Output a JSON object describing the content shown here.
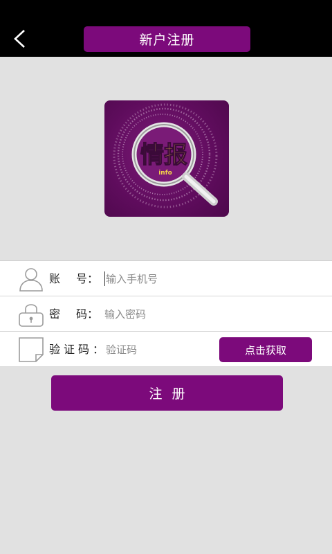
{
  "header": {
    "title": "新户注册",
    "back_icon": "chevron-left-icon"
  },
  "logo": {
    "text": "情报",
    "subtext": "info"
  },
  "form": {
    "account": {
      "label_a": "账",
      "label_b": "号：",
      "placeholder": "输入手机号",
      "icon": "user-icon"
    },
    "password": {
      "label_a": "密",
      "label_b": "码：",
      "placeholder": "输入密码",
      "icon": "lock-icon"
    },
    "code": {
      "label": "验证码：",
      "placeholder": "验证码",
      "icon": "note-icon",
      "button_label": "点击获取"
    }
  },
  "submit_label": "注册",
  "colors": {
    "brand": "#7c0a7b",
    "topbar": "#000000",
    "background": "#e1e1e1"
  }
}
